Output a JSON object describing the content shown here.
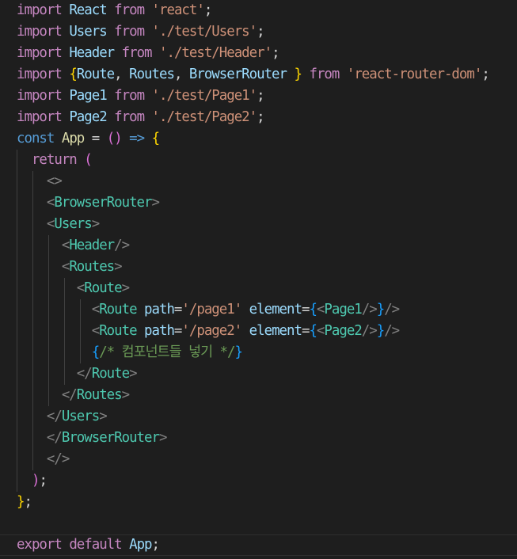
{
  "editor": {
    "language": "javascript-react",
    "theme_colors": {
      "background": "#1e1e1e",
      "keyword": "#c586c0",
      "declaration": "#569cd6",
      "variable": "#9cdcfe",
      "string": "#ce9178",
      "tag": "#4ec9b0",
      "comment": "#6a9955",
      "bracket_level1": "#ffd700",
      "bracket_level2": "#da70d6",
      "bracket_level3": "#179fff"
    },
    "lines": [
      {
        "guides": [],
        "tokens": [
          [
            "kw",
            "import"
          ],
          [
            "punc",
            " "
          ],
          [
            "var",
            "React"
          ],
          [
            "punc",
            " "
          ],
          [
            "kw",
            "from"
          ],
          [
            "punc",
            " "
          ],
          [
            "str",
            "'react'"
          ],
          [
            "punc",
            ";"
          ]
        ]
      },
      {
        "guides": [],
        "tokens": [
          [
            "kw",
            "import"
          ],
          [
            "punc",
            " "
          ],
          [
            "var",
            "Users"
          ],
          [
            "punc",
            " "
          ],
          [
            "kw",
            "from"
          ],
          [
            "punc",
            " "
          ],
          [
            "str",
            "'./test/Users'"
          ],
          [
            "punc",
            ";"
          ]
        ]
      },
      {
        "guides": [],
        "tokens": [
          [
            "kw",
            "import"
          ],
          [
            "punc",
            " "
          ],
          [
            "var",
            "Header"
          ],
          [
            "punc",
            " "
          ],
          [
            "kw",
            "from"
          ],
          [
            "punc",
            " "
          ],
          [
            "str",
            "'./test/Header'"
          ],
          [
            "punc",
            ";"
          ]
        ]
      },
      {
        "guides": [],
        "tokens": [
          [
            "kw",
            "import"
          ],
          [
            "punc",
            " "
          ],
          [
            "br1",
            "{"
          ],
          [
            "var",
            "Route"
          ],
          [
            "punc",
            ", "
          ],
          [
            "var",
            "Routes"
          ],
          [
            "punc",
            ", "
          ],
          [
            "var",
            "BrowserRouter"
          ],
          [
            "punc",
            " "
          ],
          [
            "br1",
            "}"
          ],
          [
            "punc",
            " "
          ],
          [
            "kw",
            "from"
          ],
          [
            "punc",
            " "
          ],
          [
            "str",
            "'react-router-dom'"
          ],
          [
            "punc",
            ";"
          ]
        ]
      },
      {
        "guides": [],
        "tokens": [
          [
            "kw",
            "import"
          ],
          [
            "punc",
            " "
          ],
          [
            "var",
            "Page1"
          ],
          [
            "punc",
            " "
          ],
          [
            "kw",
            "from"
          ],
          [
            "punc",
            " "
          ],
          [
            "str",
            "'./test/Page1'"
          ],
          [
            "punc",
            ";"
          ]
        ]
      },
      {
        "guides": [],
        "tokens": [
          [
            "kw",
            "import"
          ],
          [
            "punc",
            " "
          ],
          [
            "var",
            "Page2"
          ],
          [
            "punc",
            " "
          ],
          [
            "kw",
            "from"
          ],
          [
            "punc",
            " "
          ],
          [
            "str",
            "'./test/Page2'"
          ],
          [
            "punc",
            ";"
          ]
        ]
      },
      {
        "guides": [],
        "tokens": [
          [
            "dkw",
            "const"
          ],
          [
            "punc",
            " "
          ],
          [
            "fn",
            "App"
          ],
          [
            "punc",
            " "
          ],
          [
            "op",
            "="
          ],
          [
            "punc",
            " "
          ],
          [
            "br2",
            "()"
          ],
          [
            "punc",
            " "
          ],
          [
            "dkw",
            "=>"
          ],
          [
            "punc",
            " "
          ],
          [
            "br1",
            "{"
          ]
        ]
      },
      {
        "guides": [
          1
        ],
        "tokens": [
          [
            "punc",
            "  "
          ],
          [
            "kw",
            "return"
          ],
          [
            "punc",
            " "
          ],
          [
            "br2",
            "("
          ]
        ]
      },
      {
        "guides": [
          1,
          2
        ],
        "tokens": [
          [
            "punc",
            "    "
          ],
          [
            "angle",
            "<>"
          ]
        ]
      },
      {
        "guides": [
          1,
          2
        ],
        "tokens": [
          [
            "punc",
            "    "
          ],
          [
            "angle",
            "<"
          ],
          [
            "tag",
            "BrowserRouter"
          ],
          [
            "angle",
            ">"
          ]
        ]
      },
      {
        "guides": [
          1,
          2
        ],
        "tokens": [
          [
            "punc",
            "    "
          ],
          [
            "angle",
            "<"
          ],
          [
            "tag",
            "Users"
          ],
          [
            "angle",
            ">"
          ]
        ]
      },
      {
        "guides": [
          1,
          2,
          3
        ],
        "tokens": [
          [
            "punc",
            "      "
          ],
          [
            "angle",
            "<"
          ],
          [
            "tag",
            "Header"
          ],
          [
            "angle",
            "/>"
          ]
        ]
      },
      {
        "guides": [
          1,
          2,
          3
        ],
        "tokens": [
          [
            "punc",
            "      "
          ],
          [
            "angle",
            "<"
          ],
          [
            "tag",
            "Routes"
          ],
          [
            "angle",
            ">"
          ]
        ]
      },
      {
        "guides": [
          1,
          2,
          3,
          4
        ],
        "tokens": [
          [
            "punc",
            "        "
          ],
          [
            "angle",
            "<"
          ],
          [
            "tag",
            "Route"
          ],
          [
            "angle",
            ">"
          ]
        ]
      },
      {
        "guides": [
          1,
          2,
          3,
          4,
          5
        ],
        "tokens": [
          [
            "punc",
            "          "
          ],
          [
            "angle",
            "<"
          ],
          [
            "tag",
            "Route"
          ],
          [
            "punc",
            " "
          ],
          [
            "var",
            "path"
          ],
          [
            "op",
            "="
          ],
          [
            "str",
            "'/page1'"
          ],
          [
            "punc",
            " "
          ],
          [
            "var",
            "element"
          ],
          [
            "op",
            "="
          ],
          [
            "br3",
            "{"
          ],
          [
            "angle",
            "<"
          ],
          [
            "tag",
            "Page1"
          ],
          [
            "angle",
            "/>"
          ],
          [
            "br3",
            "}"
          ],
          [
            "angle",
            "/>"
          ]
        ]
      },
      {
        "guides": [
          1,
          2,
          3,
          4,
          5
        ],
        "tokens": [
          [
            "punc",
            "          "
          ],
          [
            "angle",
            "<"
          ],
          [
            "tag",
            "Route"
          ],
          [
            "punc",
            " "
          ],
          [
            "var",
            "path"
          ],
          [
            "op",
            "="
          ],
          [
            "str",
            "'/page2'"
          ],
          [
            "punc",
            " "
          ],
          [
            "var",
            "element"
          ],
          [
            "op",
            "="
          ],
          [
            "br3",
            "{"
          ],
          [
            "angle",
            "<"
          ],
          [
            "tag",
            "Page2"
          ],
          [
            "angle",
            "/>"
          ],
          [
            "br3",
            "}"
          ],
          [
            "angle",
            "/>"
          ]
        ]
      },
      {
        "guides": [
          1,
          2,
          3,
          4,
          5
        ],
        "tokens": [
          [
            "punc",
            "          "
          ],
          [
            "br3",
            "{"
          ],
          [
            "comment",
            "/* 컴포넌트들 넣기 */"
          ],
          [
            "br3",
            "}"
          ]
        ]
      },
      {
        "guides": [
          1,
          2,
          3,
          4
        ],
        "tokens": [
          [
            "punc",
            "        "
          ],
          [
            "angle",
            "</"
          ],
          [
            "tag",
            "Route"
          ],
          [
            "angle",
            ">"
          ]
        ]
      },
      {
        "guides": [
          1,
          2,
          3
        ],
        "tokens": [
          [
            "punc",
            "      "
          ],
          [
            "angle",
            "</"
          ],
          [
            "tag",
            "Routes"
          ],
          [
            "angle",
            ">"
          ]
        ]
      },
      {
        "guides": [
          1,
          2
        ],
        "tokens": [
          [
            "punc",
            "    "
          ],
          [
            "angle",
            "</"
          ],
          [
            "tag",
            "Users"
          ],
          [
            "angle",
            ">"
          ]
        ]
      },
      {
        "guides": [
          1,
          2
        ],
        "tokens": [
          [
            "punc",
            "    "
          ],
          [
            "angle",
            "</"
          ],
          [
            "tag",
            "BrowserRouter"
          ],
          [
            "angle",
            ">"
          ]
        ]
      },
      {
        "guides": [
          1,
          2
        ],
        "tokens": [
          [
            "punc",
            "    "
          ],
          [
            "angle",
            "</>"
          ]
        ]
      },
      {
        "guides": [
          1
        ],
        "tokens": [
          [
            "punc",
            "  "
          ],
          [
            "br2",
            ")"
          ],
          [
            "punc",
            ";"
          ]
        ]
      },
      {
        "guides": [],
        "tokens": [
          [
            "br1",
            "}"
          ],
          [
            "punc",
            ";"
          ]
        ]
      },
      {
        "guides": [],
        "tokens": []
      },
      {
        "guides": [],
        "current": true,
        "tokens": [
          [
            "kw",
            "export"
          ],
          [
            "punc",
            " "
          ],
          [
            "kw",
            "default"
          ],
          [
            "punc",
            " "
          ],
          [
            "var",
            "App"
          ],
          [
            "punc",
            ";"
          ]
        ]
      }
    ]
  }
}
